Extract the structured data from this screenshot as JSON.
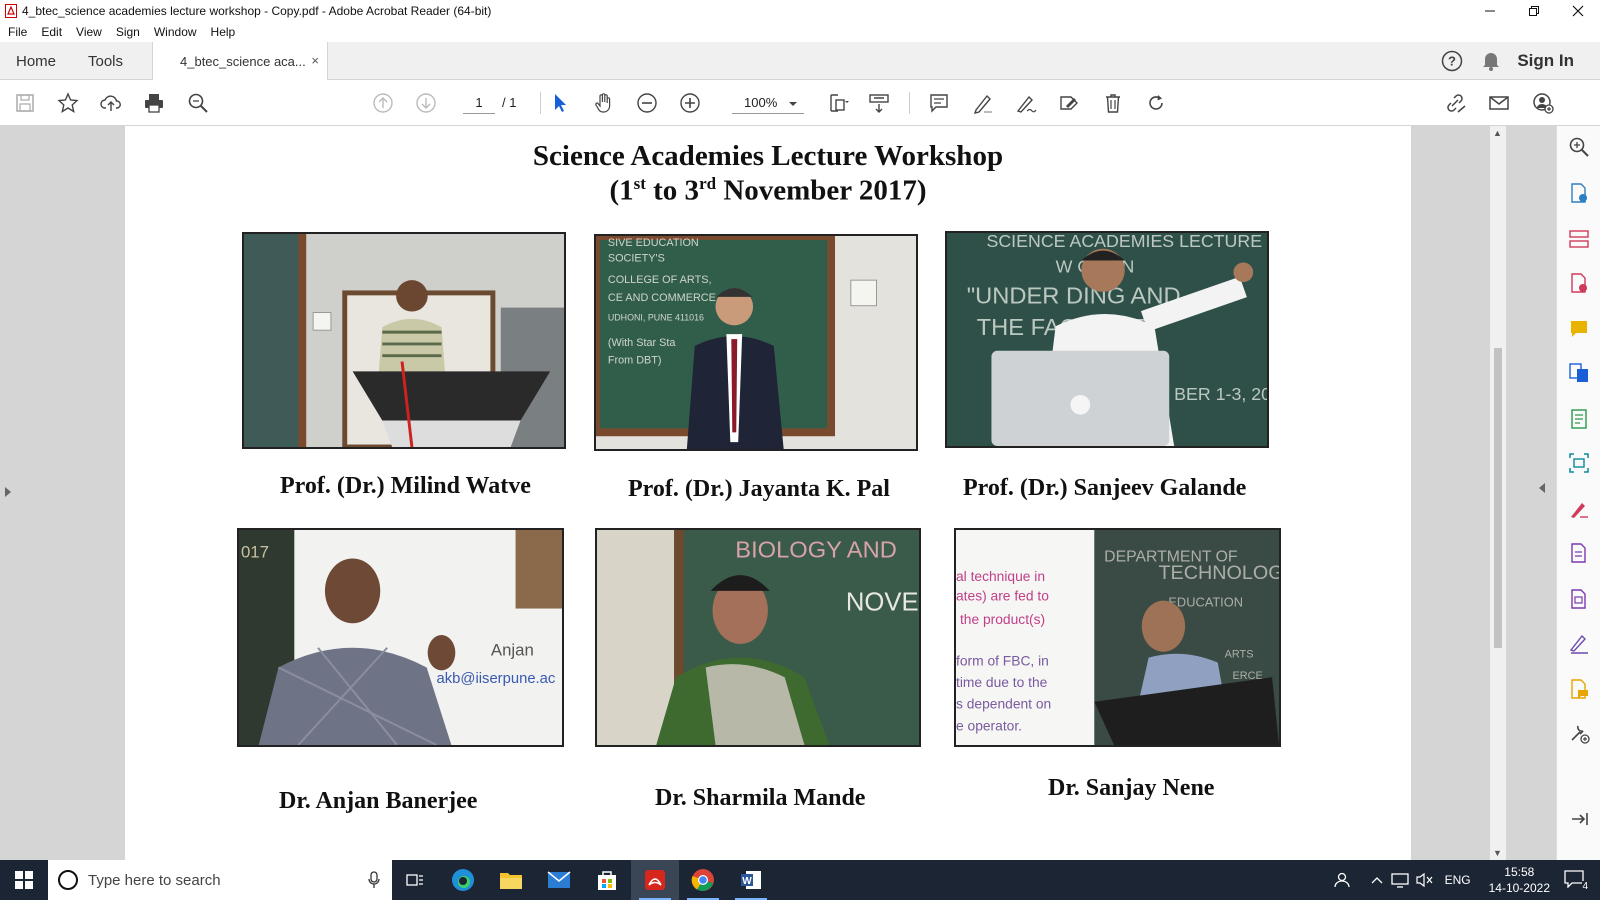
{
  "window": {
    "title": "4_btec_science academies lecture workshop - Copy.pdf - Adobe Acrobat Reader (64-bit)"
  },
  "menu": [
    "File",
    "Edit",
    "View",
    "Sign",
    "Window",
    "Help"
  ],
  "tabs": {
    "home": "Home",
    "tools": "Tools",
    "document": "4_btec_science aca...",
    "close_glyph": "×",
    "sign_in": "Sign In"
  },
  "toolbar": {
    "page_current": "1",
    "page_separator": "/",
    "page_total": "1",
    "zoom": "100%"
  },
  "document": {
    "title_line1": "Science Academies Lecture Workshop",
    "title_line2": {
      "open": "(1",
      "sup1": "st",
      "mid": " to 3",
      "sup2": "rd",
      "close": " November 2017)"
    },
    "speakers": [
      {
        "name": "Prof. (Dr.) Milind Watve",
        "photo": "speaker-at-podium-photo",
        "accent": "#8a7a5a"
      },
      {
        "name": "Prof. (Dr.) Jayanta K. Pal",
        "photo": "speaker-before-chalkboard-photo",
        "accent": "#2f5a48"
      },
      {
        "name": "Prof. (Dr.) Sanjeev Galande",
        "photo": "speaker-with-laptop-photo",
        "accent": "#2e5048"
      },
      {
        "name": "Dr. Anjan Banerjee",
        "photo": "speaker-before-slide-photo",
        "accent": "#5a5a6a"
      },
      {
        "name": "Dr. Sharmila Mande",
        "photo": "speaker-in-saree-photo",
        "accent": "#3a5a4a"
      },
      {
        "name": "Dr. Sanjay Nene",
        "photo": "speaker-at-lectern-photo",
        "accent": "#3a4a44"
      }
    ],
    "slide_text": {
      "board_b": [
        "SIVE EDUCATION",
        "SOCIETY'S",
        "COLLEGE OF ARTS,",
        "CE AND COMMERCE",
        "UDHONI, PUNE 411016",
        "(With Star Sta",
        "From DBT)"
      ],
      "board_c": [
        "SCIENCE ACADEMIES LECTURE",
        "W    OP  ON",
        "\"UNDER    DING AND",
        "THE     FACES BE",
        "BER 1-3, 20"
      ],
      "slide_d": [
        "Anjan",
        "akb@iiserpune.ac",
        "017"
      ],
      "board_e": [
        "BIOLOGY AND",
        "NOVEM"
      ],
      "slide_f": [
        "al technique in",
        "ates) are fed to",
        "the product(s)",
        "form of FBC, in",
        "time due to the",
        "s dependent on",
        "e operator."
      ],
      "board_f": [
        "DEPARTMENT OF",
        "TECHNOLOGY",
        "EDUCATION",
        "ARTS",
        "ERCE"
      ]
    }
  },
  "taskbar": {
    "search_placeholder": "Type here to search",
    "language": "ENG",
    "time": "15:58",
    "date": "14-10-2022",
    "notification_count": "4"
  }
}
